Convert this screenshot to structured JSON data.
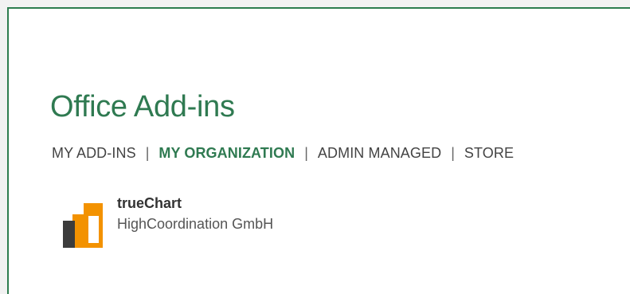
{
  "header": {
    "title": "Office Add-ins"
  },
  "tabs": [
    {
      "label": "MY ADD-INS",
      "active": false
    },
    {
      "label": "MY ORGANIZATION",
      "active": true
    },
    {
      "label": "ADMIN MANAGED",
      "active": false
    },
    {
      "label": "STORE",
      "active": false
    }
  ],
  "separator": "|",
  "addins": [
    {
      "name": "trueChart",
      "publisher": "HighCoordination GmbH",
      "icon": "truechart-logo-icon"
    }
  ],
  "colors": {
    "accent": "#2f7a51",
    "logo_orange": "#f39200",
    "logo_dark": "#3c3c3c"
  }
}
